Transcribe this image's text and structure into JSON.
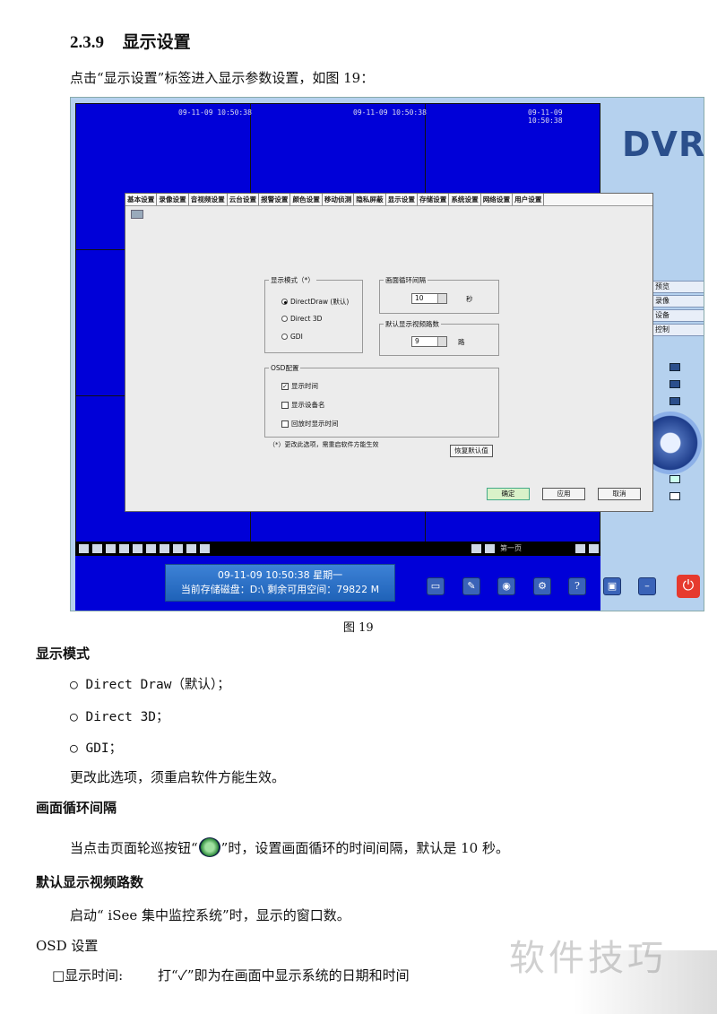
{
  "section": {
    "number": "2.3.9",
    "title": "显示设置"
  },
  "intro": "点击“显示设置”标签进入显示参数设置，如图 19：",
  "screenshot": {
    "timestamps": [
      "09-11-09 10:50:38",
      "09-11-09 10:50:38",
      "09-11-09 10:50:38"
    ],
    "logo": "DVR",
    "tabs": [
      "基本设置",
      "录像设置",
      "音视频设置",
      "云台设置",
      "报警设置",
      "颜色设置",
      "移动侦测",
      "隐私屏蔽",
      "显示设置",
      "存储设置",
      "系统设置",
      "网络设置",
      "用户设置"
    ],
    "active_tab": "显示设置",
    "display_mode": {
      "label": "显示模式（*）",
      "options": [
        "DirectDraw (默认)",
        "Direct 3D",
        "GDI"
      ],
      "selected": "DirectDraw (默认)"
    },
    "cycle_interval": {
      "label": "画面循环间隔",
      "value": "10",
      "unit": "秒"
    },
    "default_channels": {
      "label": "默认显示视频路数",
      "value": "9",
      "unit": "路"
    },
    "osd": {
      "label": "OSD配置",
      "items": [
        {
          "label": "显示时间",
          "checked": true
        },
        {
          "label": "显示设备名",
          "checked": false
        },
        {
          "label": "回放时显示时间",
          "checked": false
        }
      ]
    },
    "note": "（*）更改此选项，需重启软件方能生效",
    "restore_button": "恢复默认值",
    "ok_button": "确定",
    "apply_button": "应用",
    "cancel_button": "取消",
    "side_buttons": [
      "预览",
      "录像",
      "设备",
      "控制"
    ],
    "page_label": "第一页",
    "status_time": "09-11-09    10:50:38      星期一",
    "status_disk": "当前存储磁盘：D:\\     剩余可用空间：79822 M"
  },
  "figure_caption": "图 19",
  "display_mode_heading": "显示模式",
  "display_mode_items": [
    "○ Direct Draw（默认）；",
    "○ Direct 3D；",
    "○ GDI；"
  ],
  "display_mode_note": "更改此选项，须重启软件方能生效。",
  "cycle_heading": "画面循环间隔",
  "cycle_text_a": "当点击页面轮巡按钮“",
  "cycle_text_b": "”时，设置画面循环的时间间隔，默认是 10 秒。",
  "channels_heading": "默认显示视频路数",
  "channels_text": "启动“ iSee 集中监控系统”时，显示的窗口数。",
  "osd_heading": "OSD 设置",
  "osd_line_a": "□显示时间:",
  "osd_line_b": "打“✓”即为在画面中显示系统的日期和时间",
  "watermark": "软件技巧"
}
